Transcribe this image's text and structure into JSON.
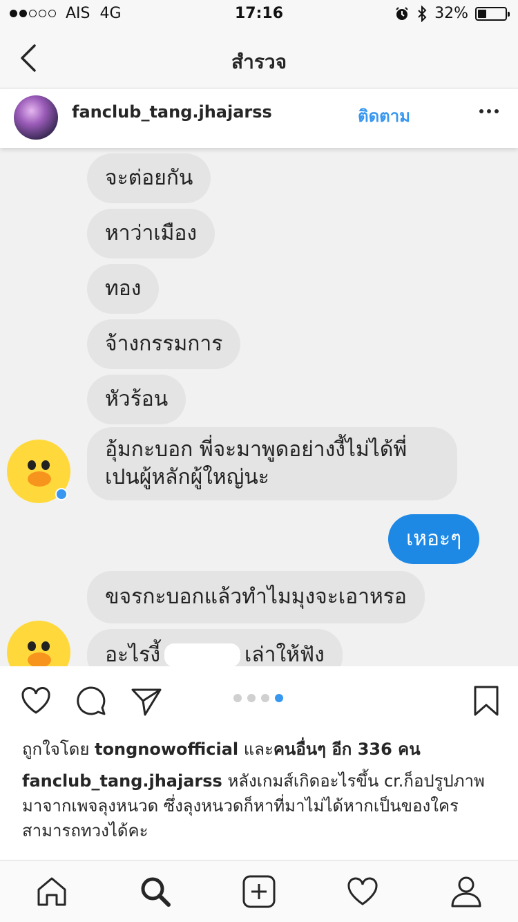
{
  "status": {
    "signal_dots_filled": 2,
    "signal_dots_total": 5,
    "carrier": "AIS",
    "network": "4G",
    "time": "17:16",
    "battery_text": "32%",
    "battery_level": 0.32
  },
  "nav": {
    "title": "สำรวจ"
  },
  "post": {
    "username": "fanclub_tang.jhajarss",
    "follow_label": "ติดตาม"
  },
  "chat": {
    "messages": [
      {
        "text": "จะต่อยกัน",
        "from": "other"
      },
      {
        "text": "หาว่าเมือง",
        "from": "other"
      },
      {
        "text": "ทอง",
        "from": "other"
      },
      {
        "text": "จ้างกรรมการ",
        "from": "other"
      },
      {
        "text": "หัวร้อน",
        "from": "other"
      },
      {
        "line1": "อุ้มกะบอก พี่จะมาพูดอย่างงี้ไม่ได้พี่",
        "line2": "เปนผู้หลักผู้ใหญ่นะ",
        "from": "other"
      },
      {
        "text": "เหอะๆ",
        "from": "me"
      },
      {
        "text": "ขจรกะบอกแล้วทำไมมุงจะเอาหรอ",
        "from": "other"
      },
      {
        "text_a": "อะไรงี้",
        "text_b": "เล่าให้ฟัง",
        "from": "other"
      }
    ]
  },
  "carousel": {
    "count": 4,
    "active_index": 3
  },
  "likes": {
    "prefix": "ถูกใจโดย",
    "user": "tongnowofficial",
    "middle": "และ",
    "others": "คนอื่นๆ อีก 336 คน"
  },
  "caption": {
    "username": "fanclub_tang.jhajarss",
    "text": "หลังเกมส์เกิดอะไรขึ้น cr.ก็อปรูปภาพมาจากเพจลุงหนวด ซึ่งลุงหนวดก็หาที่มาไม่ได้หากเป็นของใครสามารถทวงได้คะ"
  },
  "colors": {
    "accent": "#3897f0",
    "bubble_other": "#e4e4e4",
    "bubble_me": "#1e88e5"
  },
  "icons": {
    "like": "heart-icon",
    "comment": "comment-icon",
    "share": "paper-plane-icon",
    "save": "bookmark-icon",
    "home": "home-icon",
    "search": "search-icon",
    "add": "plus-square-icon",
    "activity": "heart-icon",
    "profile": "profile-icon"
  }
}
